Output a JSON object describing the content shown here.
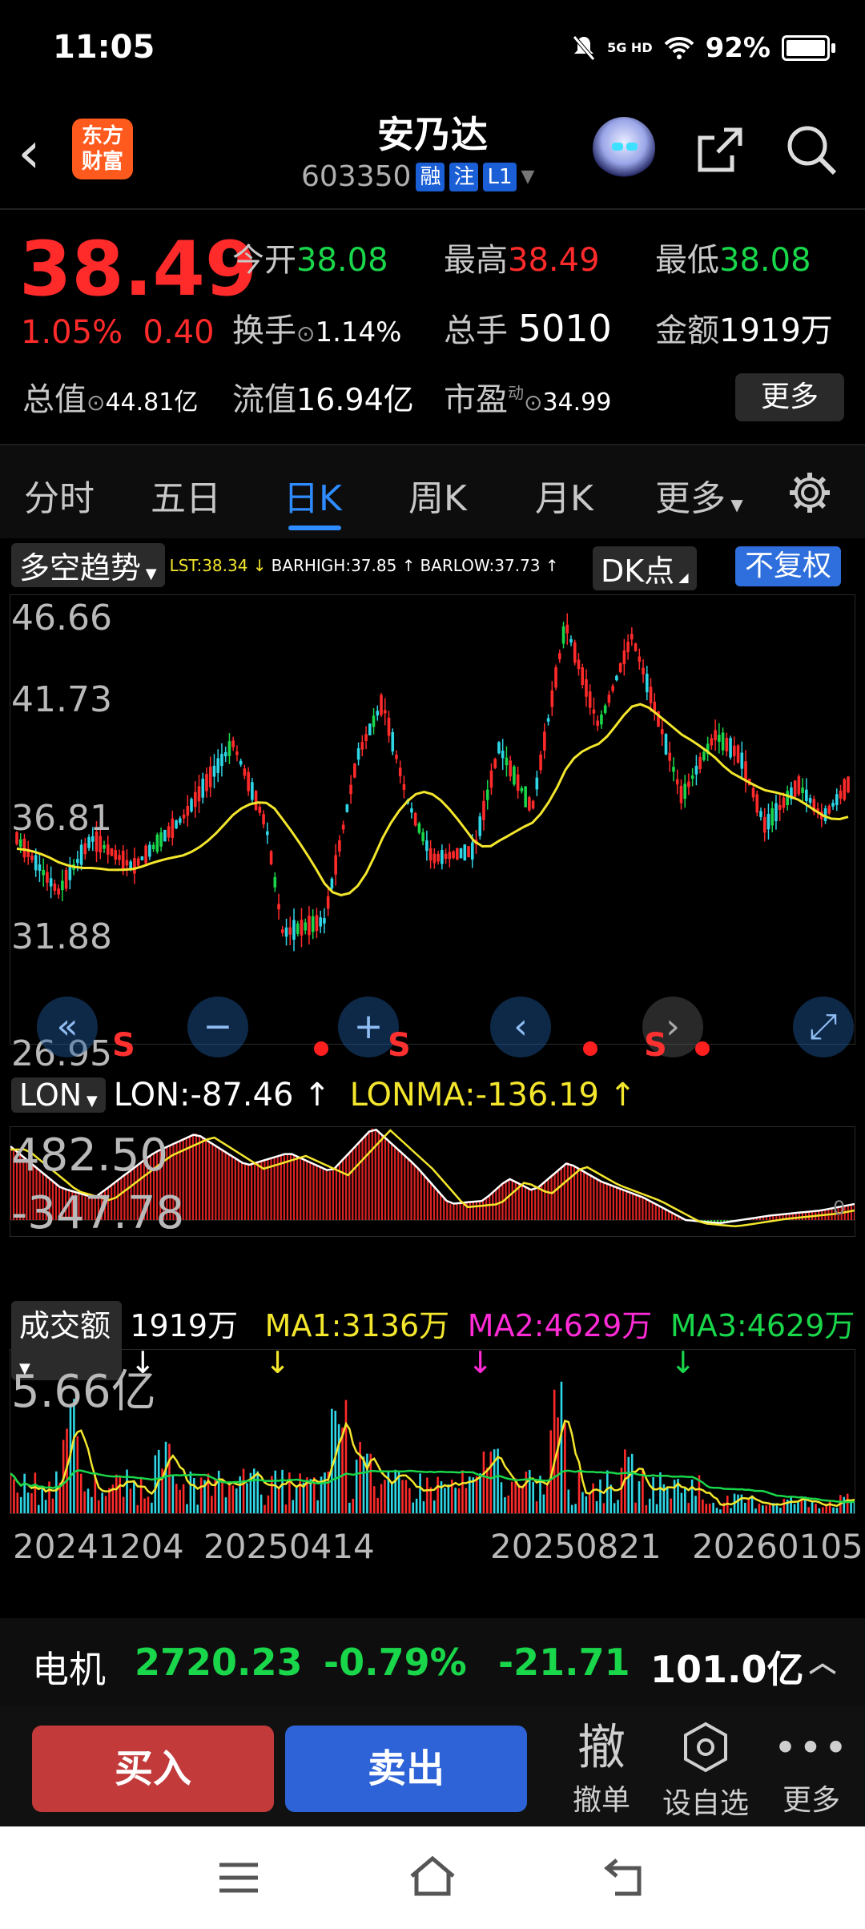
{
  "status": {
    "time": "11:05",
    "network": "5G HD",
    "battery": "92%"
  },
  "header": {
    "logo_line1": "东方",
    "logo_line2": "财富",
    "stock_name": "安乃达",
    "stock_code": "603350",
    "tag_margin": "融",
    "tag_note": "注",
    "tag_level": "L1"
  },
  "quote": {
    "price": "38.49",
    "pct": "1.05%",
    "change": "0.40",
    "open_label": "今开",
    "open": "38.08",
    "high_label": "最高",
    "high": "38.49",
    "low_label": "最低",
    "low": "38.08",
    "turnover_label": "换手",
    "turnover": "1.14%",
    "volume_label": "总手",
    "volume": "5010",
    "amount_label": "金额",
    "amount": "1919万",
    "mktcap_label": "总值",
    "mktcap": "44.81亿",
    "float_label": "流值",
    "float": "16.94亿",
    "pe_label": "市盈",
    "pe_sup": "动",
    "pe": "34.99",
    "more": "更多"
  },
  "tabs": [
    "分时",
    "五日",
    "日K",
    "周K",
    "月K",
    "更多"
  ],
  "active_tab": "日K",
  "kline": {
    "indicator": "多空趋势",
    "lst": "LST:38.34 ↓",
    "barhigh": "BARHIGH:37.85 ↑",
    "barlow": "BARLOW:37.73 ↑",
    "dk": "DK点",
    "fq": "不复权",
    "y_labels": [
      "46.66",
      "41.73",
      "36.81",
      "31.88",
      "26.95"
    ],
    "signal": "S"
  },
  "lon": {
    "name": "LON",
    "value": "LON:-87.46 ↑",
    "lonma": "LONMA:-136.19 ↑",
    "top": "482.50",
    "bottom": "-347.78",
    "zero": "0"
  },
  "vol": {
    "name": "成交额",
    "value": "1919万 ↓",
    "ma1": "MA1:3136万 ↓",
    "ma2": "MA2:4629万 ↓",
    "ma3": "MA3:4629万 ↓",
    "top": "5.66亿"
  },
  "x_dates": [
    "20241204",
    "20250414",
    "20250821",
    "20260105"
  ],
  "index_bar": {
    "name": "电机",
    "value": "2720.23",
    "pct": "-0.79%",
    "change": "-21.71",
    "amount": "101.0亿"
  },
  "actions": {
    "buy": "买入",
    "sell": "卖出",
    "cancel_icon": "撤",
    "cancel": "撤单",
    "watch": "设自选",
    "more": "更多"
  },
  "colors": {
    "up": "#ff2a2a",
    "down": "#19d64a",
    "accent": "#2e8cff",
    "ma": "#f3e62c"
  }
}
